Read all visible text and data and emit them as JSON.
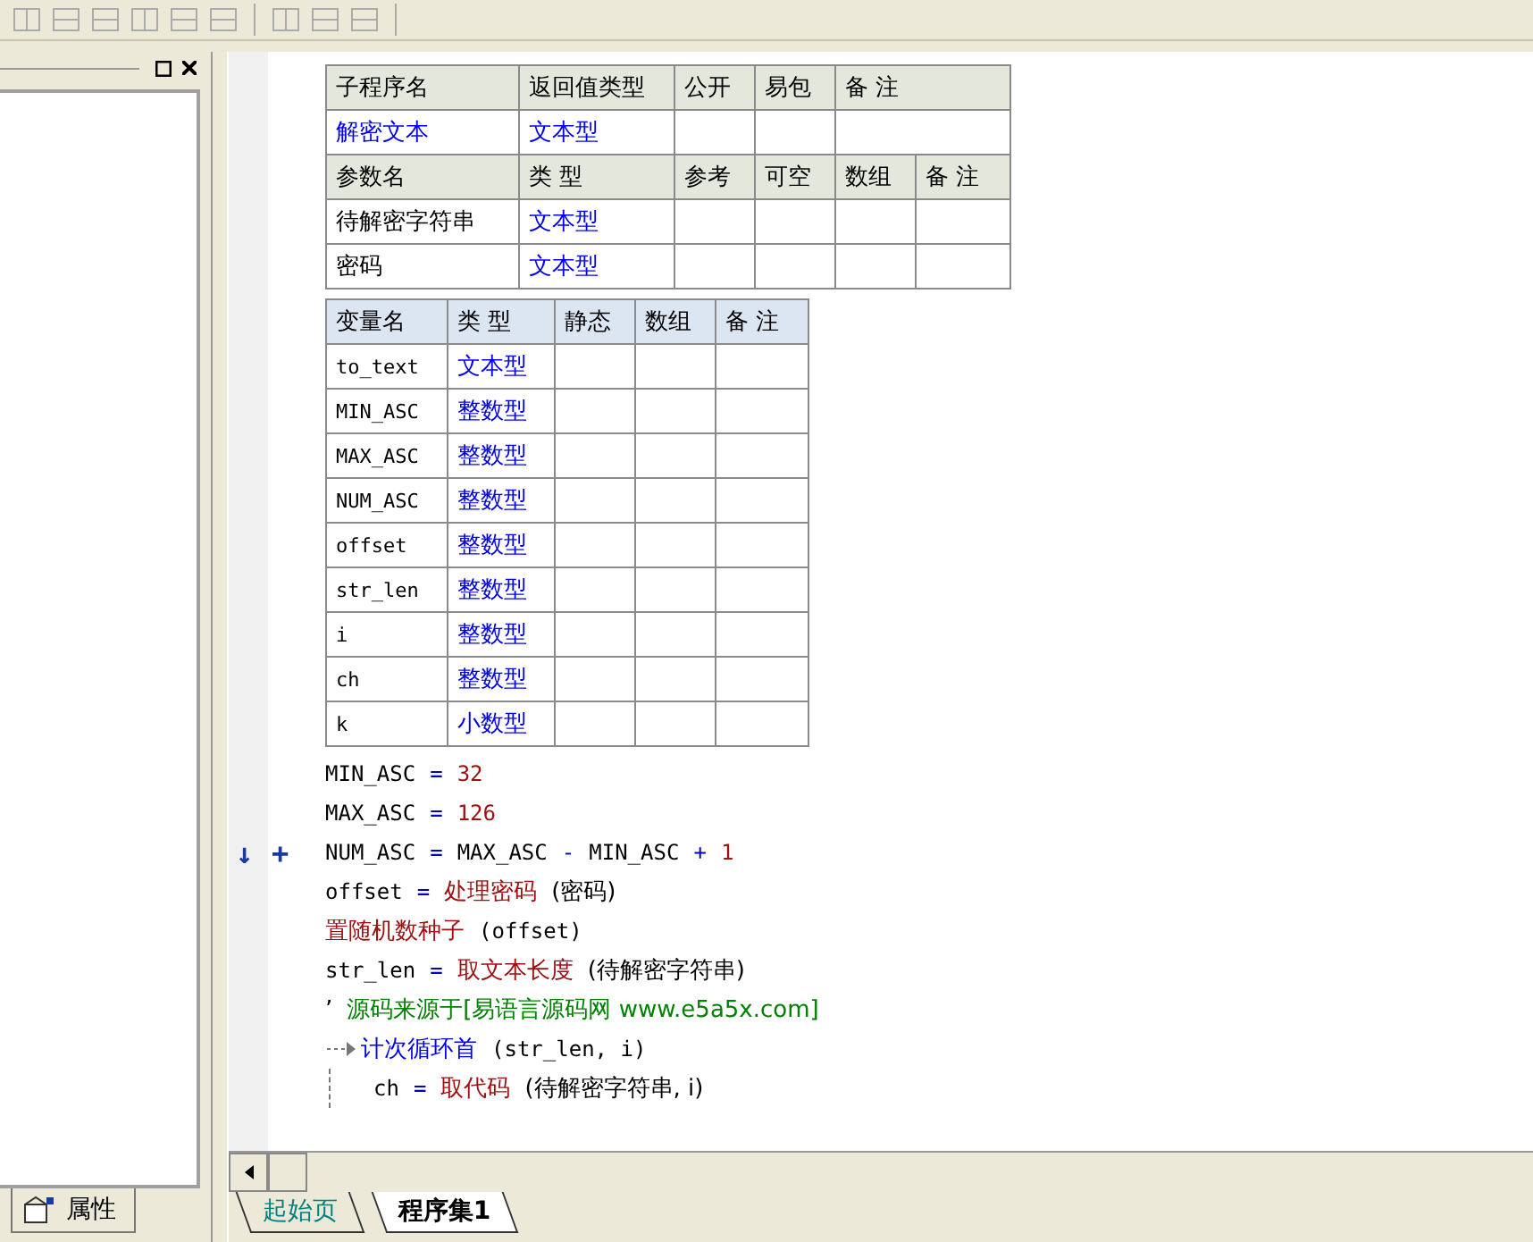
{
  "left_panel": {
    "tab": "属性"
  },
  "routine_table": {
    "header": [
      "子程序名",
      "返回值类型",
      "公开",
      "易包",
      "备 注"
    ],
    "row": {
      "name": "解密文本",
      "type": "文本型"
    }
  },
  "param_table": {
    "header": [
      "参数名",
      "类 型",
      "参考",
      "可空",
      "数组",
      "备 注"
    ],
    "rows": [
      {
        "name": "待解密字符串",
        "type": "文本型"
      },
      {
        "name": "密码",
        "type": "文本型"
      }
    ]
  },
  "var_table": {
    "header": [
      "变量名",
      "类 型",
      "静态",
      "数组",
      "备 注"
    ],
    "rows": [
      {
        "name": "to_text",
        "type": "文本型"
      },
      {
        "name": "MIN_ASC",
        "type": "整数型"
      },
      {
        "name": "MAX_ASC",
        "type": "整数型"
      },
      {
        "name": "NUM_ASC",
        "type": "整数型"
      },
      {
        "name": "offset",
        "type": "整数型"
      },
      {
        "name": "str_len",
        "type": "整数型"
      },
      {
        "name": "i",
        "type": "整数型"
      },
      {
        "name": "ch",
        "type": "整数型"
      },
      {
        "name": "k",
        "type": "小数型"
      }
    ]
  },
  "code_lines": [
    {
      "kind": "statement",
      "tokens": [
        {
          "kind": "name",
          "text": "MIN_ASC"
        },
        {
          "kind": "op",
          "text": "="
        },
        {
          "kind": "number",
          "text": "32"
        }
      ]
    },
    {
      "kind": "statement",
      "tokens": [
        {
          "kind": "name",
          "text": "MAX_ASC"
        },
        {
          "kind": "op",
          "text": "="
        },
        {
          "kind": "number",
          "text": "126"
        }
      ]
    },
    {
      "kind": "statement",
      "arrow": "↓",
      "plus": "+",
      "tokens": [
        {
          "kind": "name",
          "text": "NUM_ASC"
        },
        {
          "kind": "op",
          "text": "="
        },
        {
          "kind": "name",
          "text": "MAX_ASC"
        },
        {
          "kind": "op",
          "text": "-"
        },
        {
          "kind": "name",
          "text": "MIN_ASC"
        },
        {
          "kind": "op",
          "text": "+"
        },
        {
          "kind": "number",
          "text": "1"
        }
      ]
    },
    {
      "kind": "statement",
      "tokens": [
        {
          "kind": "name",
          "text": "offset"
        },
        {
          "kind": "op",
          "text": "="
        },
        {
          "kind": "call",
          "text": "处理密码"
        },
        {
          "kind": "name",
          "text": "(密码)"
        }
      ]
    },
    {
      "kind": "statement",
      "tokens": [
        {
          "kind": "call",
          "text": "置随机数种子"
        },
        {
          "kind": "name",
          "text": "(offset)"
        }
      ]
    },
    {
      "kind": "statement",
      "tokens": [
        {
          "kind": "name",
          "text": "str_len"
        },
        {
          "kind": "op",
          "text": "="
        },
        {
          "kind": "call",
          "text": "取文本长度"
        },
        {
          "kind": "name",
          "text": "(待解密字符串)"
        }
      ]
    },
    {
      "kind": "comment",
      "tokens": [
        {
          "kind": "name",
          "text": "’"
        },
        {
          "kind": "comment",
          "text": "源码来源于[易语言源码网 www.e5a5x.com]"
        }
      ]
    },
    {
      "kind": "loop",
      "tokens": [
        {
          "kind": "flow",
          "text": "计次循环首"
        },
        {
          "kind": "name",
          "text": "(str_len, i)"
        }
      ],
      "children": [
        {
          "kind": "statement",
          "tokens": [
            {
              "kind": "name",
              "text": "ch"
            },
            {
              "kind": "op",
              "text": "="
            },
            {
              "kind": "call",
              "text": "取代码"
            },
            {
              "kind": "name",
              "text": "(待解密字符串, i)"
            }
          ]
        }
      ]
    }
  ],
  "doc_tabs": [
    {
      "label": "起始页",
      "selected": false
    },
    {
      "label": "程序集1",
      "selected": true
    }
  ]
}
